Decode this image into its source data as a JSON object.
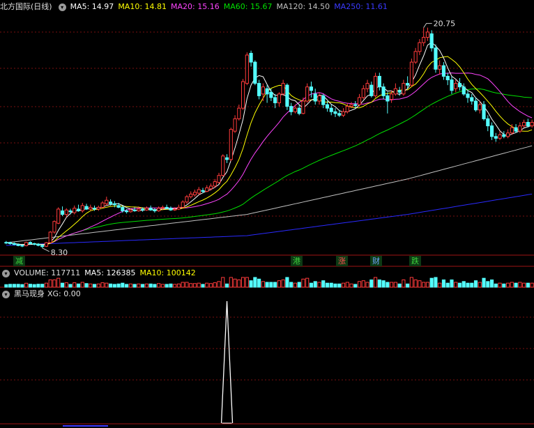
{
  "header": {
    "title": "北方国际(日线)",
    "ma5": "MA5: 14.97",
    "ma10": "MA10: 14.81",
    "ma20": "MA20: 15.16",
    "ma60": "MA60: 15.67",
    "ma120": "MA120: 14.50",
    "ma250": "MA250: 11.61"
  },
  "volume_header": {
    "label": "VOLUME: 117711",
    "ma5": "MA5: 126385",
    "ma10": "MA10: 100142"
  },
  "indicator_header": {
    "name": "黑马现身",
    "value": "XG: 0.00"
  },
  "events": [
    {
      "label": "减",
      "color": "#3cd23c"
    },
    {
      "label": "港",
      "color": "#3cd23c"
    },
    {
      "label": "涨",
      "color": "#ff5050"
    },
    {
      "label": "财",
      "color": "#6fa4ff"
    },
    {
      "label": "跌",
      "color": "#3cd23c"
    }
  ],
  "colors": {
    "up": "#ff3b3b",
    "down": "#54ffff",
    "ma5": "#ffffff",
    "ma10": "#ffff00",
    "ma20": "#ff44ff",
    "ma60": "#00e000",
    "ma120": "#c0c0c0",
    "ma250": "#2a2aff",
    "grid": "#7a1010"
  },
  "chart_data": {
    "type": "candlestick",
    "high_label": "20.75",
    "low_label": "8.30",
    "candles": [
      [
        8.62,
        8.6,
        8.7,
        8.52
      ],
      [
        8.61,
        8.55,
        8.66,
        8.48
      ],
      [
        8.56,
        8.5,
        8.62,
        8.45
      ],
      [
        8.5,
        8.44,
        8.56,
        8.4
      ],
      [
        8.45,
        8.42,
        8.5,
        8.35
      ],
      [
        8.43,
        8.62,
        8.66,
        8.4
      ],
      [
        8.62,
        8.55,
        8.68,
        8.5
      ],
      [
        8.55,
        8.52,
        8.6,
        8.45
      ],
      [
        8.52,
        8.45,
        8.58,
        8.4
      ],
      [
        8.45,
        8.38,
        8.5,
        8.3
      ],
      [
        8.4,
        8.6,
        8.64,
        8.36
      ],
      [
        8.6,
        9.2,
        9.26,
        8.58
      ],
      [
        9.2,
        9.8,
        9.86,
        9.1
      ],
      [
        9.7,
        10.5,
        10.6,
        9.65
      ],
      [
        10.4,
        10.2,
        10.65,
        10.1
      ],
      [
        10.2,
        10.45,
        10.55,
        10.05
      ],
      [
        10.4,
        10.35,
        10.52,
        10.2
      ],
      [
        10.3,
        10.55,
        10.7,
        10.2
      ],
      [
        10.5,
        10.4,
        10.75,
        10.35
      ],
      [
        10.4,
        10.7,
        10.85,
        10.3
      ],
      [
        10.65,
        10.5,
        10.8,
        10.45
      ],
      [
        10.5,
        10.6,
        10.75,
        10.4
      ],
      [
        10.55,
        10.5,
        10.7,
        10.4
      ],
      [
        10.5,
        10.6,
        10.7,
        10.4
      ],
      [
        10.6,
        10.85,
        10.95,
        10.55
      ],
      [
        10.8,
        11.0,
        11.2,
        10.7
      ],
      [
        10.9,
        10.8,
        11.05,
        10.7
      ],
      [
        10.8,
        10.75,
        10.95,
        10.6
      ],
      [
        10.7,
        10.6,
        10.85,
        10.55
      ],
      [
        10.6,
        10.4,
        10.7,
        10.3
      ],
      [
        10.4,
        10.35,
        10.5,
        10.25
      ],
      [
        10.35,
        10.45,
        10.55,
        10.3
      ],
      [
        10.45,
        10.4,
        10.6,
        10.35
      ],
      [
        10.4,
        10.5,
        10.65,
        10.35
      ],
      [
        10.5,
        10.45,
        10.6,
        10.35
      ],
      [
        10.45,
        10.55,
        10.65,
        10.4
      ],
      [
        10.55,
        10.45,
        10.7,
        10.4
      ],
      [
        10.45,
        10.4,
        10.55,
        10.3
      ],
      [
        10.4,
        10.55,
        10.65,
        10.35
      ],
      [
        10.55,
        10.6,
        10.7,
        10.45
      ],
      [
        10.6,
        10.55,
        10.75,
        10.5
      ],
      [
        10.55,
        10.45,
        10.65,
        10.4
      ],
      [
        10.45,
        10.5,
        10.6,
        10.4
      ],
      [
        10.5,
        10.6,
        10.75,
        10.45
      ],
      [
        10.6,
        10.9,
        11.0,
        10.55
      ],
      [
        10.9,
        11.2,
        11.3,
        10.8
      ],
      [
        11.2,
        11.35,
        11.5,
        11.1
      ],
      [
        11.3,
        11.45,
        11.6,
        11.2
      ],
      [
        11.4,
        11.6,
        11.75,
        11.3
      ],
      [
        11.55,
        11.5,
        11.7,
        11.4
      ],
      [
        11.5,
        11.7,
        11.85,
        11.45
      ],
      [
        11.65,
        11.8,
        11.95,
        11.55
      ],
      [
        11.8,
        12.05,
        12.2,
        11.7
      ],
      [
        12.0,
        12.4,
        12.55,
        11.95
      ],
      [
        12.4,
        13.5,
        13.6,
        12.35
      ],
      [
        13.4,
        13.3,
        13.6,
        13.1
      ],
      [
        13.3,
        15.0,
        15.1,
        13.2
      ],
      [
        14.9,
        15.6,
        15.8,
        14.8
      ],
      [
        15.6,
        16.2,
        16.4,
        15.5
      ],
      [
        16.2,
        17.7,
        17.85,
        16.1
      ],
      [
        17.6,
        19.2,
        19.35,
        17.5
      ],
      [
        19.3,
        18.8,
        19.45,
        18.55
      ],
      [
        18.8,
        17.6,
        18.9,
        17.5
      ],
      [
        17.6,
        16.9,
        17.8,
        16.7
      ],
      [
        17.0,
        17.4,
        17.6,
        16.6
      ],
      [
        17.3,
        17.0,
        17.5,
        16.5
      ],
      [
        17.1,
        16.8,
        17.3,
        16.6
      ],
      [
        16.8,
        16.5,
        17.0,
        16.2
      ],
      [
        16.5,
        17.0,
        17.1,
        16.3
      ],
      [
        17.0,
        17.6,
        17.8,
        16.9
      ],
      [
        17.5,
        16.3,
        17.6,
        16.1
      ],
      [
        16.3,
        16.0,
        16.5,
        15.8
      ],
      [
        16.0,
        16.2,
        16.4,
        15.9
      ],
      [
        16.2,
        15.9,
        16.4,
        15.8
      ],
      [
        15.9,
        16.6,
        16.8,
        15.85
      ],
      [
        16.6,
        17.4,
        17.6,
        16.5
      ],
      [
        17.4,
        17.2,
        17.7,
        16.8
      ],
      [
        17.0,
        16.6,
        17.3,
        16.4
      ],
      [
        16.6,
        16.9,
        17.1,
        16.4
      ],
      [
        16.9,
        16.4,
        17.0,
        16.2
      ],
      [
        16.4,
        16.2,
        16.6,
        16.0
      ],
      [
        16.2,
        16.0,
        16.4,
        15.8
      ],
      [
        16.0,
        15.9,
        16.2,
        15.7
      ],
      [
        15.9,
        15.8,
        16.1,
        15.7
      ],
      [
        15.8,
        16.0,
        16.2,
        15.7
      ],
      [
        16.0,
        16.3,
        16.5,
        15.9
      ],
      [
        16.3,
        16.4,
        16.55,
        16.2
      ],
      [
        16.4,
        16.35,
        16.6,
        16.2
      ],
      [
        16.4,
        16.8,
        17.0,
        16.3
      ],
      [
        16.8,
        17.3,
        17.5,
        16.7
      ],
      [
        17.3,
        17.6,
        17.8,
        17.1
      ],
      [
        17.5,
        16.9,
        17.7,
        16.8
      ],
      [
        16.9,
        18.0,
        18.2,
        16.8
      ],
      [
        18.0,
        17.4,
        18.2,
        17.2
      ],
      [
        17.4,
        16.9,
        17.6,
        16.7
      ],
      [
        16.9,
        16.6,
        17.1,
        15.9
      ],
      [
        16.7,
        17.0,
        17.2,
        16.5
      ],
      [
        17.0,
        17.3,
        17.6,
        16.9
      ],
      [
        17.2,
        17.1,
        17.4,
        16.9
      ],
      [
        17.0,
        17.6,
        17.8,
        16.9
      ],
      [
        17.6,
        17.5,
        18.0,
        17.3
      ],
      [
        17.5,
        18.8,
        19.0,
        17.4
      ],
      [
        18.8,
        19.4,
        19.6,
        18.7
      ],
      [
        19.4,
        19.9,
        20.1,
        19.2
      ],
      [
        19.9,
        20.2,
        20.75,
        19.7
      ],
      [
        20.2,
        20.5,
        20.75,
        20.0
      ],
      [
        20.4,
        19.6,
        20.6,
        19.4
      ],
      [
        19.6,
        18.4,
        19.8,
        18.2
      ],
      [
        18.4,
        18.6,
        18.9,
        18.1
      ],
      [
        18.6,
        18.0,
        18.8,
        17.8
      ],
      [
        18.0,
        17.8,
        18.2,
        17.5
      ],
      [
        17.8,
        17.2,
        18.0,
        17.0
      ],
      [
        17.3,
        17.6,
        17.8,
        17.1
      ],
      [
        17.6,
        17.4,
        17.9,
        17.2
      ],
      [
        17.4,
        17.0,
        17.6,
        16.9
      ],
      [
        17.0,
        16.8,
        17.2,
        16.5
      ],
      [
        16.8,
        16.6,
        17.0,
        16.4
      ],
      [
        16.6,
        16.1,
        16.8,
        16.0
      ],
      [
        16.1,
        16.4,
        16.6,
        15.9
      ],
      [
        16.4,
        15.6,
        16.6,
        15.5
      ],
      [
        15.6,
        15.2,
        15.8,
        14.9
      ],
      [
        15.2,
        14.6,
        15.4,
        14.4
      ],
      [
        14.6,
        14.5,
        14.8,
        14.3
      ],
      [
        14.5,
        14.7,
        14.9,
        14.4
      ],
      [
        14.7,
        14.6,
        14.9,
        14.5
      ],
      [
        14.6,
        14.8,
        15.0,
        14.5
      ],
      [
        14.8,
        15.1,
        15.3,
        14.7
      ],
      [
        15.1,
        14.9,
        15.3,
        14.8
      ],
      [
        14.9,
        15.2,
        15.4,
        14.8
      ],
      [
        15.2,
        15.4,
        15.55,
        15.1
      ],
      [
        15.4,
        15.2,
        15.6,
        15.1
      ],
      [
        15.2,
        15.4,
        15.55,
        15.1
      ]
    ],
    "ma120": [
      [
        0,
        8.6
      ],
      [
        60,
        10.2
      ],
      [
        100,
        12.2
      ],
      [
        138,
        14.5
      ]
    ],
    "ma250": [
      [
        0,
        8.45
      ],
      [
        60,
        9.0
      ],
      [
        100,
        10.2
      ],
      [
        138,
        11.61
      ]
    ],
    "indicator_signal_index": 55
  }
}
